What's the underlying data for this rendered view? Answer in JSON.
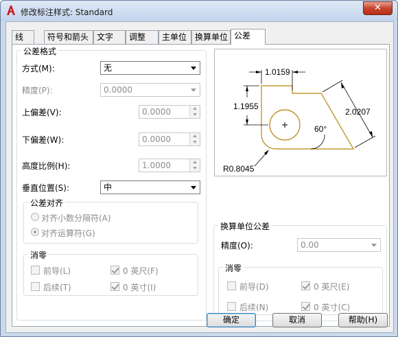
{
  "window": {
    "title": "修改标注样式: Standard",
    "close_label": "✕"
  },
  "tabs": [
    {
      "label": "线"
    },
    {
      "label": "符号和箭头"
    },
    {
      "label": "文字"
    },
    {
      "label": "调整"
    },
    {
      "label": "主单位"
    },
    {
      "label": "换算单位"
    },
    {
      "label": "公差"
    }
  ],
  "format": {
    "title": "公差格式",
    "method_label": "方式(M):",
    "method_value": "无",
    "precision_label": "精度(P):",
    "precision_value": "0.0000",
    "upper_label": "上偏差(V):",
    "upper_value": "0.0000",
    "lower_label": "下偏差(W):",
    "lower_value": "0.0000",
    "height_label": "高度比例(H):",
    "height_value": "1.0000",
    "vpos_label": "垂直位置(S):",
    "vpos_value": "中"
  },
  "alignment": {
    "title": "公差对齐",
    "decimal_label": "对齐小数分隔符(A)",
    "operator_label": "对齐运算符(G)"
  },
  "zero1": {
    "title": "消零",
    "leading_label": "前导(L)",
    "trailing_label": "后续(T)",
    "feet_label": "0 英尺(F)",
    "inches_label": "0 英寸(I)"
  },
  "alt": {
    "title": "换算单位公差",
    "precision_label": "精度(O):",
    "precision_value": "0.00"
  },
  "zero2": {
    "title": "消零",
    "leading_label": "前导(D)",
    "trailing_label": "后续(N)",
    "feet_label": "0 英尺(E)",
    "inches_label": "0 英寸(C)"
  },
  "preview": {
    "dim_top": "1.0159",
    "dim_left": "1.1955",
    "dim_right": "2.0207",
    "angle": "60°",
    "radius": "R0.8045"
  },
  "buttons": {
    "ok": "确定",
    "cancel": "取消",
    "help": "帮助(H)"
  },
  "colors": {
    "shape": "#b8860b",
    "accent": "#3c7fb1"
  }
}
